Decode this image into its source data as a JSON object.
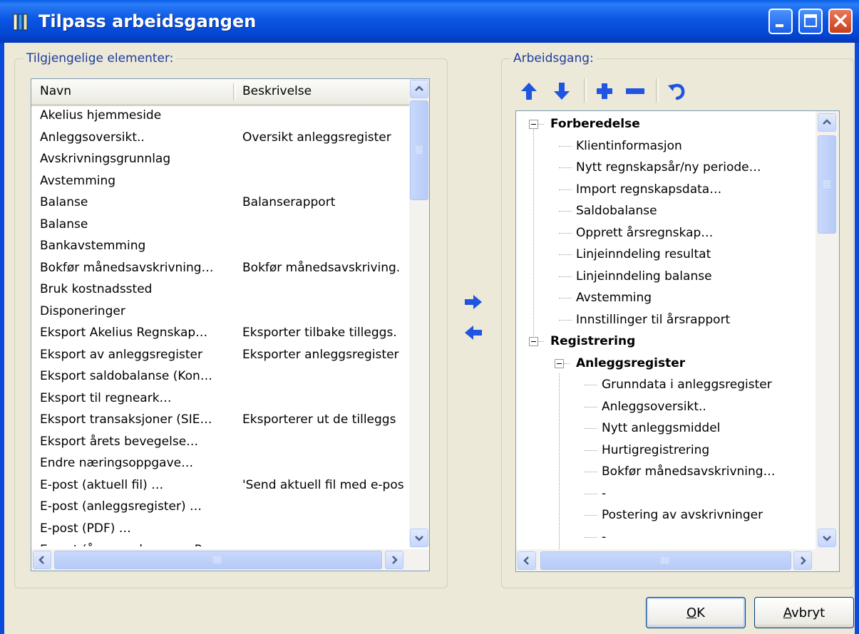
{
  "window": {
    "title": "Tilpass arbeidsgangen"
  },
  "available": {
    "legend": "Tilgjengelige elementer:",
    "columns": {
      "name": "Navn",
      "description": "Beskrivelse"
    },
    "rows": [
      {
        "name": "Akelius hjemmeside",
        "description": ""
      },
      {
        "name": "Anleggsoversikt..",
        "description": "Oversikt anleggsregister"
      },
      {
        "name": "Avskrivningsgrunnlag",
        "description": ""
      },
      {
        "name": "Avstemming",
        "description": ""
      },
      {
        "name": "Balanse",
        "description": "Balanserapport"
      },
      {
        "name": "Balanse",
        "description": ""
      },
      {
        "name": "Bankavstemming",
        "description": ""
      },
      {
        "name": "Bokfør månedsavskrivning…",
        "description": "Bokfør månedsavskriving."
      },
      {
        "name": "Bruk kostnadssted",
        "description": ""
      },
      {
        "name": "Disponeringer",
        "description": ""
      },
      {
        "name": "Eksport Akelius Regnskap…",
        "description": "Eksporter tilbake tilleggs."
      },
      {
        "name": "Eksport av anleggsregister",
        "description": "Eksporter anleggsregister"
      },
      {
        "name": "Eksport saldobalanse (Kon…",
        "description": ""
      },
      {
        "name": "Eksport til regneark…",
        "description": ""
      },
      {
        "name": "Eksport transaksjoner (SIE…",
        "description": "Eksporterer ut de tilleggs"
      },
      {
        "name": "Eksport årets bevegelse…",
        "description": ""
      },
      {
        "name": "Endre næringsoppgave…",
        "description": ""
      },
      {
        "name": "E-post (aktuell fil) …",
        "description": "'Send aktuell fil med e-pos"
      },
      {
        "name": "E-post (anleggsregister) …",
        "description": ""
      },
      {
        "name": "E-post (PDF) …",
        "description": ""
      },
      {
        "name": "E-post (årsregnskap som P…",
        "description": ""
      }
    ]
  },
  "workflow": {
    "legend": "Arbeidsgang:",
    "tree": [
      {
        "label": "Forberedelse",
        "level": 0,
        "bold": true,
        "expander": true
      },
      {
        "label": "Klientinformasjon",
        "level": 1
      },
      {
        "label": "Nytt regnskapsår/ny periode…",
        "level": 1
      },
      {
        "label": "Import regnskapsdata…",
        "level": 1
      },
      {
        "label": "Saldobalanse",
        "level": 1
      },
      {
        "label": "Opprett årsregnskap…",
        "level": 1
      },
      {
        "label": "Linjeinndeling resultat",
        "level": 1
      },
      {
        "label": "Linjeinndeling balanse",
        "level": 1
      },
      {
        "label": "Avstemming",
        "level": 1
      },
      {
        "label": "Innstillinger til årsrapport",
        "level": 1
      },
      {
        "label": "Registrering",
        "level": 0,
        "bold": true,
        "expander": true
      },
      {
        "label": "Anleggsregister",
        "level": 1,
        "bold": true,
        "expander": true
      },
      {
        "label": "Grunndata i anleggsregister",
        "level": 2
      },
      {
        "label": "Anleggsoversikt..",
        "level": 2
      },
      {
        "label": "Nytt anleggsmiddel",
        "level": 2
      },
      {
        "label": "Hurtigregistrering",
        "level": 2
      },
      {
        "label": "Bokfør månedsavskrivning…",
        "level": 2
      },
      {
        "label": "-",
        "level": 2
      },
      {
        "label": "Postering av avskrivninger",
        "level": 2
      },
      {
        "label": "-",
        "level": 2
      }
    ]
  },
  "buttons": {
    "ok_mnemonic": "O",
    "ok_rest": "K",
    "cancel_mnemonic": "A",
    "cancel_rest": "vbryt"
  },
  "icons": {
    "move_up": "arrow-up-icon",
    "move_down": "arrow-down-icon",
    "add": "plus-icon",
    "remove": "minus-icon",
    "reset": "undo-icon",
    "add_to_workflow": "arrow-right-icon",
    "remove_from_workflow": "arrow-left-icon"
  },
  "colors": {
    "titlebar": "#0a56e3",
    "accent_blue": "#1f55e0",
    "legend_text": "#1e3c9e",
    "dialog_bg": "#ece9d8"
  }
}
